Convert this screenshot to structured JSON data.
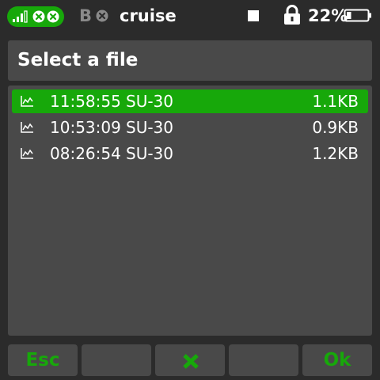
{
  "status_bar": {
    "receiver_label": "B",
    "flight_mode": "cruise",
    "battery_percent": "22%",
    "battery_level": 0.22,
    "colors": {
      "accent": "#17a80a",
      "dim": "#8a8a8a"
    },
    "icons": [
      "signal-bars-icon",
      "close-circle-icon",
      "stop-square-icon",
      "lock-icon",
      "battery-icon"
    ]
  },
  "dialog": {
    "title": "Select a file",
    "files": [
      {
        "time": "11:58:55",
        "name": "SU-30",
        "size": "1.1KB",
        "selected": true
      },
      {
        "time": "10:53:09",
        "name": "SU-30",
        "size": "0.9KB",
        "selected": false
      },
      {
        "time": "08:26:54",
        "name": "SU-30",
        "size": "1.2KB",
        "selected": false
      }
    ],
    "file_icon": "line-graph-icon"
  },
  "buttons": {
    "esc": "Esc",
    "ok": "Ok",
    "delete_icon": "close-icon"
  }
}
